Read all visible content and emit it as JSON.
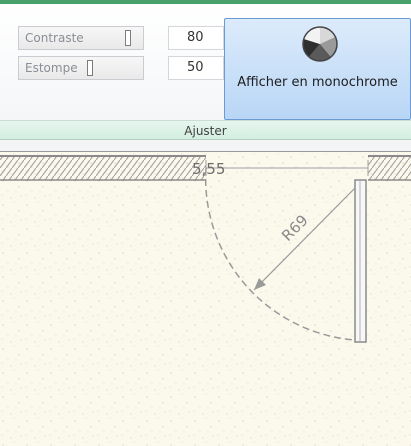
{
  "ribbon": {
    "contrast": {
      "label": "Contraste",
      "value": "80",
      "level": 0.8
    },
    "blur": {
      "label": "Estompe",
      "value": "50",
      "level": 0.5
    },
    "monochrome_button_label": "Afficher en monochrome",
    "group_label": "Ajuster"
  },
  "drawing": {
    "dimension_label": "5,55",
    "radius_label": "R69"
  },
  "colors": {
    "ribbon_top_border": "#4aa06a",
    "button_highlight": "#b9d6f6",
    "canvas_background": "#fbf8ec"
  }
}
